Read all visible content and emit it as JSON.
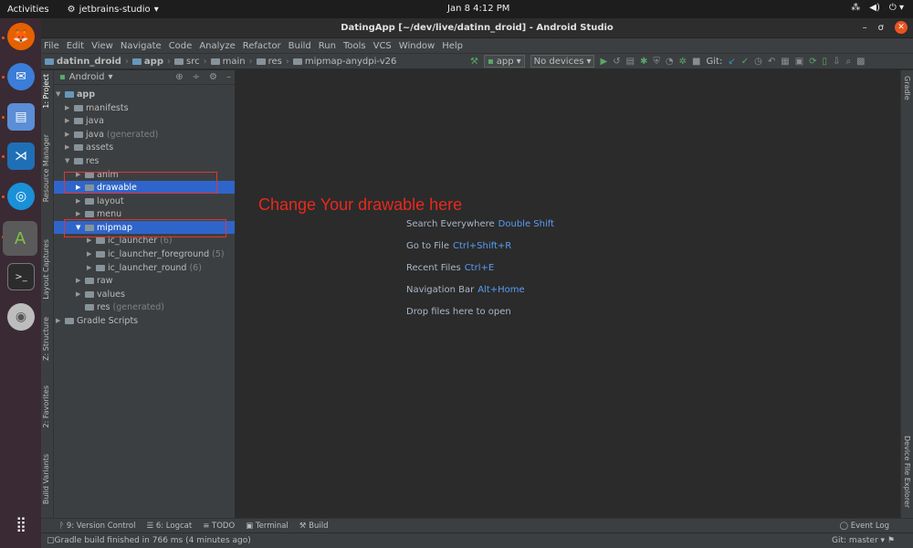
{
  "system_bar": {
    "activities": "Activities",
    "app_menu": "jetbrains-studio",
    "clock": "Jan 8  4:12 PM"
  },
  "window": {
    "title": "DatingApp [~/dev/live/datinn_droid] - Android Studio"
  },
  "menu": [
    "File",
    "Edit",
    "View",
    "Navigate",
    "Code",
    "Analyze",
    "Refactor",
    "Build",
    "Run",
    "Tools",
    "VCS",
    "Window",
    "Help"
  ],
  "breadcrumb": [
    "datinn_droid",
    "app",
    "src",
    "main",
    "res",
    "mipmap-anydpi-v26"
  ],
  "toolbar": {
    "run_config": "app",
    "device": "No devices",
    "git_label": "Git:"
  },
  "project_panel": {
    "view": "Android",
    "tree": [
      {
        "label": "app",
        "extra": "",
        "depth": 0,
        "arrow": "open",
        "selected": false,
        "bold": true
      },
      {
        "label": "manifests",
        "extra": "",
        "depth": 1,
        "arrow": "closed",
        "selected": false
      },
      {
        "label": "java",
        "extra": "",
        "depth": 1,
        "arrow": "closed",
        "selected": false
      },
      {
        "label": "java",
        "extra": "(generated)",
        "depth": 1,
        "arrow": "closed",
        "selected": false
      },
      {
        "label": "assets",
        "extra": "",
        "depth": 1,
        "arrow": "closed",
        "selected": false
      },
      {
        "label": "res",
        "extra": "",
        "depth": 1,
        "arrow": "open",
        "selected": false
      },
      {
        "label": "anim",
        "extra": "",
        "depth": 2,
        "arrow": "closed",
        "selected": false
      },
      {
        "label": "drawable",
        "extra": "",
        "depth": 2,
        "arrow": "closed",
        "selected": true
      },
      {
        "label": "layout",
        "extra": "",
        "depth": 2,
        "arrow": "closed",
        "selected": false
      },
      {
        "label": "menu",
        "extra": "",
        "depth": 2,
        "arrow": "closed",
        "selected": false
      },
      {
        "label": "mipmap",
        "extra": "",
        "depth": 2,
        "arrow": "open",
        "selected": true
      },
      {
        "label": "ic_launcher",
        "extra": "(6)",
        "depth": 3,
        "arrow": "closed",
        "selected": false
      },
      {
        "label": "ic_launcher_foreground",
        "extra": "(5)",
        "depth": 3,
        "arrow": "closed",
        "selected": false
      },
      {
        "label": "ic_launcher_round",
        "extra": "(6)",
        "depth": 3,
        "arrow": "closed",
        "selected": false
      },
      {
        "label": "raw",
        "extra": "",
        "depth": 2,
        "arrow": "closed",
        "selected": false
      },
      {
        "label": "values",
        "extra": "",
        "depth": 2,
        "arrow": "closed",
        "selected": false
      },
      {
        "label": "res",
        "extra": "(generated)",
        "depth": 2,
        "arrow": "none",
        "selected": false
      },
      {
        "label": "Gradle Scripts",
        "extra": "",
        "depth": 0,
        "arrow": "closed",
        "selected": false
      }
    ]
  },
  "side_tabs_left": [
    "1: Project",
    "Resource Manager",
    "Layout Captures",
    "Z: Structure",
    "2: Favorites",
    "Build Variants"
  ],
  "side_tabs_right": [
    "Gradle",
    "Device File Explorer"
  ],
  "editor": {
    "annotation": "Change Your drawable here",
    "hints": [
      {
        "label": "Search Everywhere",
        "shortcut": "Double Shift"
      },
      {
        "label": "Go to File",
        "shortcut": "Ctrl+Shift+R"
      },
      {
        "label": "Recent Files",
        "shortcut": "Ctrl+E"
      },
      {
        "label": "Navigation Bar",
        "shortcut": "Alt+Home"
      },
      {
        "label": "Drop files here to open",
        "shortcut": ""
      }
    ]
  },
  "bottom_tabs": [
    "9: Version Control",
    "6: Logcat",
    "TODO",
    "Terminal",
    "Build"
  ],
  "event_log": "Event Log",
  "status": {
    "message": "Gradle build finished in 766 ms (4 minutes ago)",
    "git": "Git: master"
  },
  "colors": {
    "selection": "#2f65ca",
    "annotation": "#e8291c",
    "shortcut": "#589df6",
    "ubuntu_accent": "#e95420"
  }
}
